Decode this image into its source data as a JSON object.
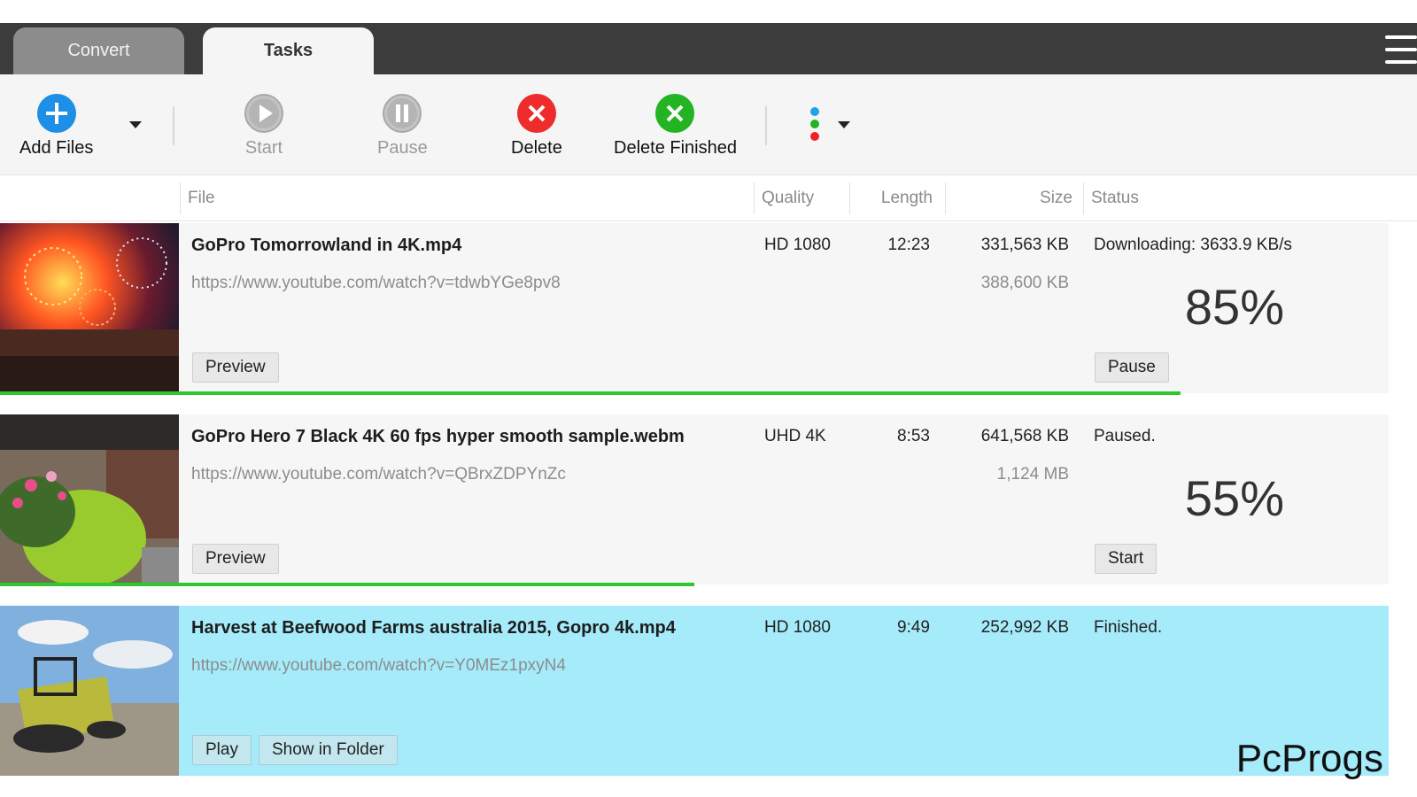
{
  "tabs": [
    {
      "label": "Convert",
      "active": false
    },
    {
      "label": "Tasks",
      "active": true
    }
  ],
  "toolbar": {
    "add_files": "Add Files",
    "start": "Start",
    "pause": "Pause",
    "delete": "Delete",
    "delete_finished": "Delete Finished"
  },
  "colors": {
    "add": "#1e8fe6",
    "delete": "#ee2c2c",
    "delete_finished": "#22b422",
    "progress": "#2ec82e",
    "finished_row": "#a5ebfa",
    "dot_blue": "#22a0ee",
    "dot_green": "#22b422",
    "dot_red": "#ee2222"
  },
  "columns": {
    "file": "File",
    "quality": "Quality",
    "length": "Length",
    "size": "Size",
    "status": "Status"
  },
  "tasks": [
    {
      "name": "GoPro  Tomorrowland in 4K.mp4",
      "url": "https://www.youtube.com/watch?v=tdwbYGe8pv8",
      "quality": "HD 1080",
      "length": "12:23",
      "size": "331,563 KB",
      "total_size": "388,600 KB",
      "status": "Downloading: 3633.9 KB/s",
      "percent": "85%",
      "progress": 0.85,
      "left_button": "Preview",
      "right_button": "Pause"
    },
    {
      "name": "GoPro Hero 7 Black 4K 60 fps hyper smooth sample.webm",
      "url": "https://www.youtube.com/watch?v=QBrxZDPYnZc",
      "quality": "UHD 4K",
      "length": "8:53",
      "size": "641,568 KB",
      "total_size": "1,124 MB",
      "status": "Paused.",
      "percent": "55%",
      "progress": 0.5,
      "left_button": "Preview",
      "right_button": "Start"
    },
    {
      "name": "Harvest at Beefwood Farms australia 2015, Gopro 4k.mp4",
      "url": "https://www.youtube.com/watch?v=Y0MEz1pxyN4",
      "quality": "HD 1080",
      "length": "9:49",
      "size": "252,992 KB",
      "status": "Finished.",
      "left_button": "Play",
      "folder_button": "Show in Folder"
    }
  ],
  "watermark": "PcProgs"
}
